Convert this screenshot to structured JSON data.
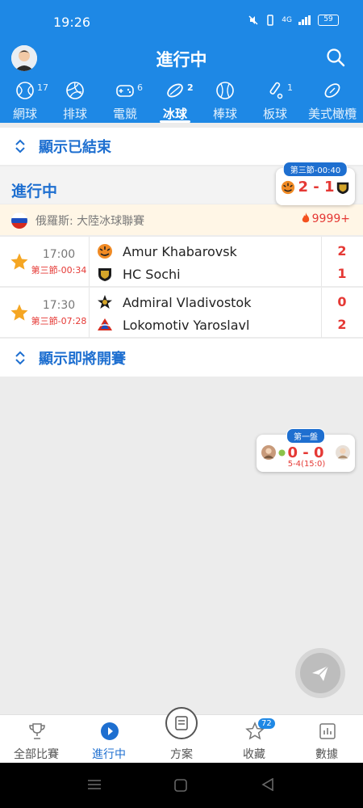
{
  "status_bar": {
    "time": "19:26",
    "battery": "59",
    "signal": "4G"
  },
  "header": {
    "title": "進行中"
  },
  "sport_tabs": [
    {
      "label": "網球",
      "count": "17",
      "icon": "tennis-icon"
    },
    {
      "label": "排球",
      "count": "",
      "icon": "volleyball-icon"
    },
    {
      "label": "電競",
      "count": "6",
      "icon": "gamepad-icon"
    },
    {
      "label": "冰球",
      "count": "2",
      "icon": "hockey-puck-icon",
      "active": true
    },
    {
      "label": "棒球",
      "count": "",
      "icon": "baseball-icon"
    },
    {
      "label": "板球",
      "count": "1",
      "icon": "cricket-icon"
    },
    {
      "label": "美式橄欖",
      "count": "",
      "icon": "football-icon"
    }
  ],
  "show_finished": "顯示已結束",
  "section_title": "進行中",
  "league": {
    "name": "俄羅斯: 大陸冰球聯賽",
    "hot": "9999+"
  },
  "matches": [
    {
      "time": "17:00",
      "period": "第三節-00:34",
      "home": "Amur Khabarovsk",
      "away": "HC Sochi",
      "home_score": "2",
      "away_score": "1"
    },
    {
      "time": "17:30",
      "period": "第三節-07:28",
      "home": "Admiral Vladivostok",
      "away": "Lokomotiv Yaroslavl",
      "home_score": "0",
      "away_score": "2"
    }
  ],
  "show_upcoming": "顯示即將開賽",
  "float_hockey": {
    "badge": "第三節-00:40",
    "score": "2 - 1"
  },
  "float_tennis": {
    "badge": "第一盤",
    "score": "0 - 0",
    "sub": "5-4(15:0)"
  },
  "bottom_nav": [
    {
      "label": "全部比賽",
      "icon": "trophy-icon"
    },
    {
      "label": "進行中",
      "icon": "play-icon",
      "active": true
    },
    {
      "label": "方案",
      "icon": "document-icon"
    },
    {
      "label": "收藏",
      "icon": "star-outline-icon",
      "badge": "72"
    },
    {
      "label": "數據",
      "icon": "bar-chart-icon"
    }
  ],
  "colors": {
    "primary": "#1e88e5",
    "accent": "#1e6fd0",
    "score_red": "#e53935",
    "star_gold": "#f5a623"
  }
}
